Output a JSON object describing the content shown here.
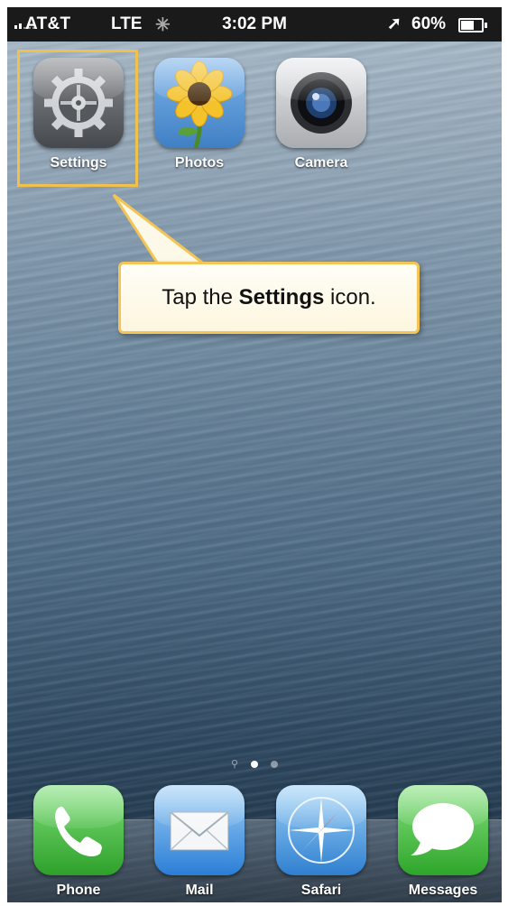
{
  "status_bar": {
    "carrier": "AT&T",
    "network": "LTE",
    "time": "3:02 PM",
    "battery": "60%",
    "battery_level": 0.6
  },
  "apps": [
    {
      "label": "Settings",
      "icon": "gear-icon"
    },
    {
      "label": "Photos",
      "icon": "sunflower-icon"
    },
    {
      "label": "Camera",
      "icon": "camera-lens-icon"
    }
  ],
  "callout": {
    "prefix": "Tap the ",
    "bold": "Settings",
    "suffix": " icon.",
    "accent": "#f2c556"
  },
  "page_indicator": {
    "pages": 2,
    "current": 1
  },
  "dock": [
    {
      "label": "Phone",
      "icon": "phone-icon"
    },
    {
      "label": "Mail",
      "icon": "mail-icon"
    },
    {
      "label": "Safari",
      "icon": "compass-icon"
    },
    {
      "label": "Messages",
      "icon": "speech-bubble-icon"
    }
  ]
}
